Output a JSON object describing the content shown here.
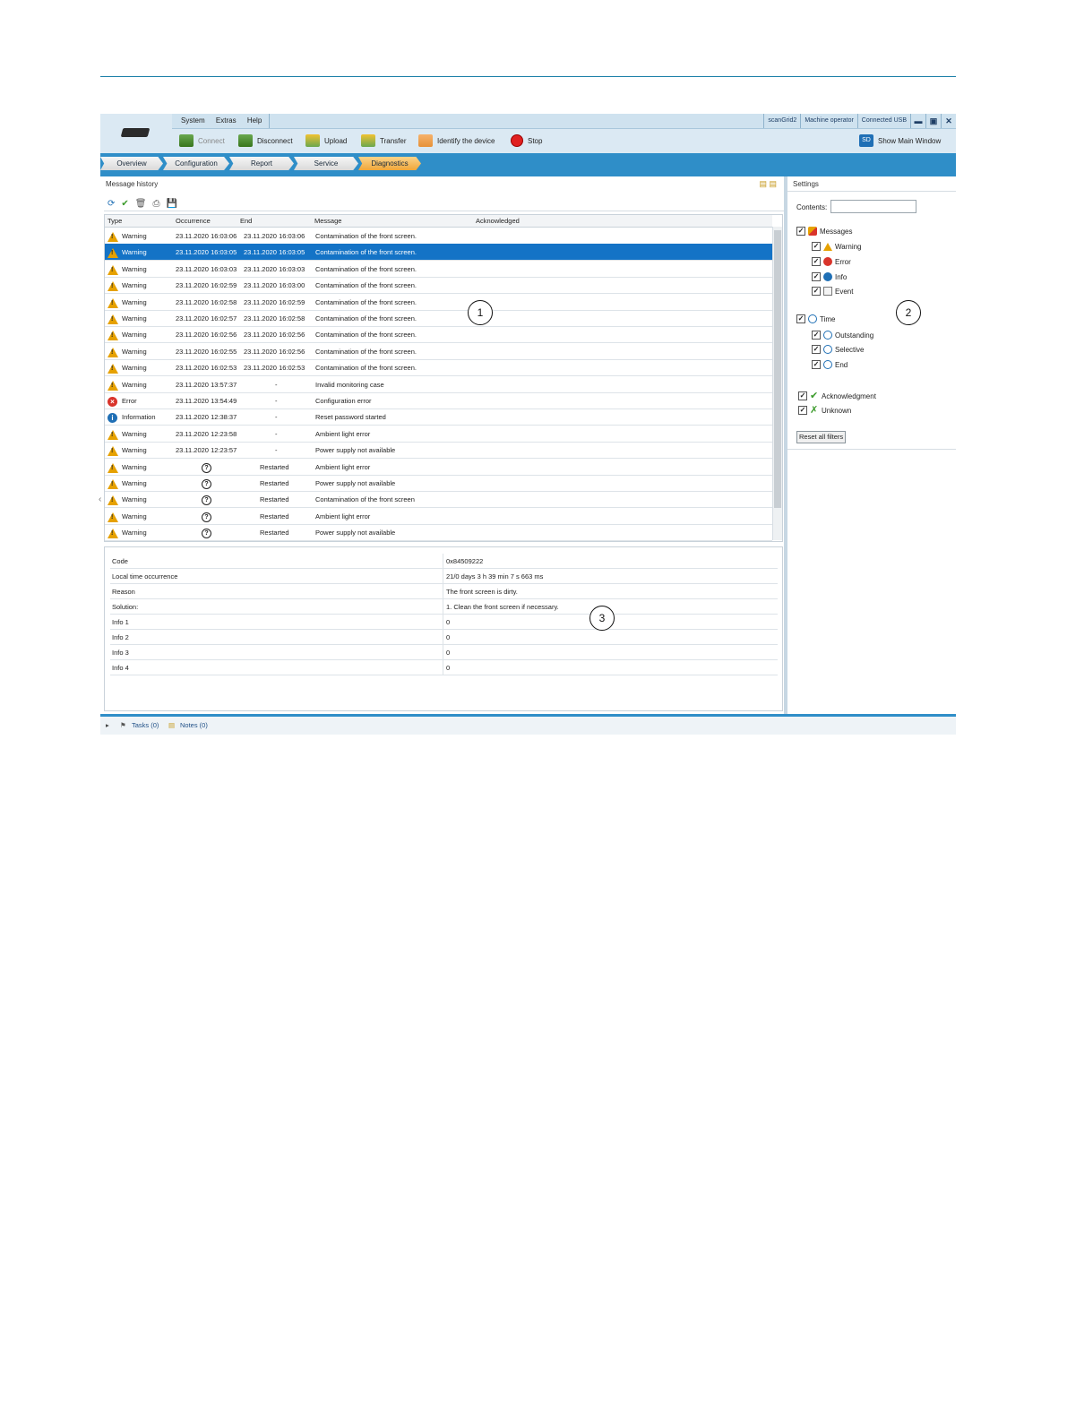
{
  "menu": {
    "items": [
      "System",
      "Extras",
      "Help"
    ]
  },
  "status": {
    "device": "scanGrid2",
    "user": "Machine operator",
    "connection": "Connected USB"
  },
  "window_controls": {
    "minimize": "▬",
    "maximize": "▣",
    "close": "✕"
  },
  "toolbar": {
    "connect": "Connect",
    "disconnect": "Disconnect",
    "upload": "Upload",
    "transfer": "Transfer",
    "identify": "Identify the device",
    "stop": "Stop",
    "show_main": "Show Main Window",
    "sd_badge": "SD"
  },
  "tabs": [
    "Overview",
    "Configuration",
    "Report",
    "Service",
    "Diagnostics"
  ],
  "message_history": {
    "title": "Message history",
    "columns": {
      "type": "Type",
      "occurrence": "Occurrence",
      "end": "End",
      "message": "Message",
      "acknowledged": "Acknowledged"
    },
    "rows": [
      {
        "icon": "warning",
        "type": "Warning",
        "occurrence": "23.11.2020 16:03:06",
        "end": "23.11.2020 16:03:06",
        "message": "Contamination of the front screen."
      },
      {
        "icon": "warning",
        "type": "Warning",
        "occurrence": "23.11.2020 16:03:05",
        "end": "23.11.2020 16:03:05",
        "message": "Contamination of the front screen.",
        "selected": true
      },
      {
        "icon": "warning",
        "type": "Warning",
        "occurrence": "23.11.2020 16:03:03",
        "end": "23.11.2020 16:03:03",
        "message": "Contamination of the front screen."
      },
      {
        "icon": "warning",
        "type": "Warning",
        "occurrence": "23.11.2020 16:02:59",
        "end": "23.11.2020 16:03:00",
        "message": "Contamination of the front screen."
      },
      {
        "icon": "warning",
        "type": "Warning",
        "occurrence": "23.11.2020 16:02:58",
        "end": "23.11.2020 16:02:59",
        "message": "Contamination of the front screen."
      },
      {
        "icon": "warning",
        "type": "Warning",
        "occurrence": "23.11.2020 16:02:57",
        "end": "23.11.2020 16:02:58",
        "message": "Contamination of the front screen."
      },
      {
        "icon": "warning",
        "type": "Warning",
        "occurrence": "23.11.2020 16:02:56",
        "end": "23.11.2020 16:02:56",
        "message": "Contamination of the front screen."
      },
      {
        "icon": "warning",
        "type": "Warning",
        "occurrence": "23.11.2020 16:02:55",
        "end": "23.11.2020 16:02:56",
        "message": "Contamination of the front screen."
      },
      {
        "icon": "warning",
        "type": "Warning",
        "occurrence": "23.11.2020 16:02:53",
        "end": "23.11.2020 16:02:53",
        "message": "Contamination of the front screen."
      },
      {
        "icon": "warning",
        "type": "Warning",
        "occurrence": "23.11.2020 13:57:37",
        "end": "-",
        "message": "Invalid monitoring case"
      },
      {
        "icon": "error",
        "type": "Error",
        "occurrence": "23.11.2020 13:54:49",
        "end": "-",
        "message": "Configuration error"
      },
      {
        "icon": "info",
        "type": "Information",
        "occurrence": "23.11.2020 12:38:37",
        "end": "-",
        "message": "Reset password started"
      },
      {
        "icon": "warning",
        "type": "Warning",
        "occurrence": "23.11.2020 12:23:58",
        "end": "-",
        "message": "Ambient light error"
      },
      {
        "icon": "warning",
        "type": "Warning",
        "occurrence": "23.11.2020 12:23:57",
        "end": "-",
        "message": "Power supply not available"
      },
      {
        "icon": "warning",
        "type": "Warning",
        "occurrence": "?",
        "end": "Restarted",
        "message": "Ambient light error"
      },
      {
        "icon": "warning",
        "type": "Warning",
        "occurrence": "?",
        "end": "Restarted",
        "message": "Power supply not available"
      },
      {
        "icon": "warning",
        "type": "Warning",
        "occurrence": "?",
        "end": "Restarted",
        "message": "Contamination of the front screen"
      },
      {
        "icon": "warning",
        "type": "Warning",
        "occurrence": "?",
        "end": "Restarted",
        "message": "Ambient light error"
      },
      {
        "icon": "warning",
        "type": "Warning",
        "occurrence": "?",
        "end": "Restarted",
        "message": "Power supply not available"
      }
    ]
  },
  "details": [
    {
      "key": "Code",
      "value": "0x84509222"
    },
    {
      "key": "Local time occurrence",
      "value": "21/0 days 3 h 39 min 7 s 663 ms"
    },
    {
      "key": "Reason",
      "value": "The front screen is dirty."
    },
    {
      "key": "Solution:",
      "value": "1. Clean the front screen if necessary."
    },
    {
      "key": "Info 1",
      "value": "0"
    },
    {
      "key": "Info 2",
      "value": "0"
    },
    {
      "key": "Info 3",
      "value": "0"
    },
    {
      "key": "Info 4",
      "value": "0"
    }
  ],
  "settings": {
    "title": "Settings",
    "contents_label": "Contents:",
    "contents_value": "",
    "filters": {
      "messages": "Messages",
      "warning": "Warning",
      "error": "Error",
      "info": "Info",
      "event": "Event",
      "time": "Time",
      "outstanding": "Outstanding",
      "selective": "Selective",
      "end": "End",
      "acknowledgment": "Acknowledgment",
      "unknown": "Unknown"
    },
    "reset_label": "Reset all filters"
  },
  "footer": {
    "tasks": "Tasks (0)",
    "notes": "Notes (0)"
  },
  "callouts": [
    "1",
    "2",
    "3"
  ],
  "colors": {
    "accent": "#2f8ec8",
    "selection": "#1473c6",
    "active_tab": "#f0a63a"
  }
}
